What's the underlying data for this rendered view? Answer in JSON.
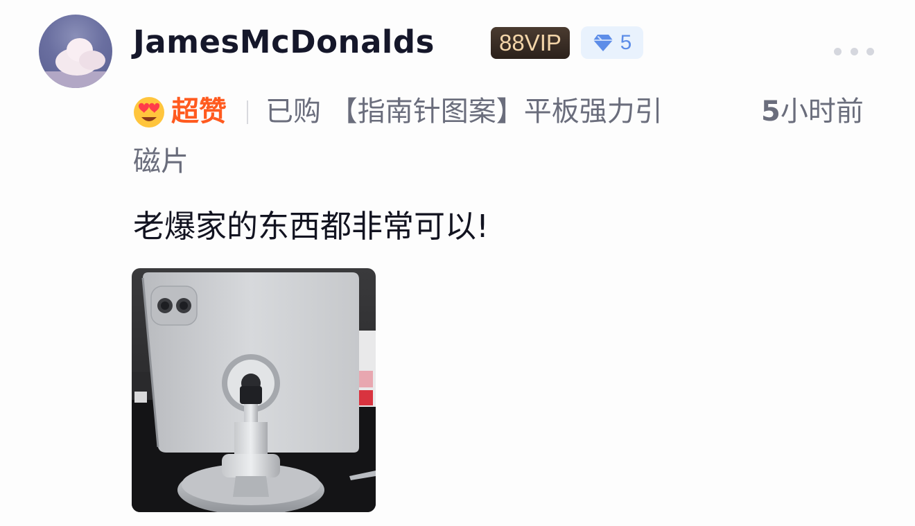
{
  "user": {
    "name": "JamesMcDonalds",
    "vip_badge": "88VIP",
    "level": "5",
    "level_icon": "diamond-icon",
    "avatar_icon": "cloud-avatar"
  },
  "review": {
    "rating_icon": "heart-eyes-emoji-icon",
    "rating_label": "超赞",
    "purchase_line1": "已购 【指南针图案】平板强力引",
    "purchase_line2": "磁片",
    "time_num": "5",
    "time_unit": "小时前",
    "text": "老爆家的东西都非常可以!",
    "photo_icon": "tablet-magnetic-stand-photo"
  },
  "colors": {
    "rating": "#ff5a1f",
    "level_badge_bg": "#e9f2fd",
    "level_text": "#5d8de8",
    "vip_bg": "#2b211b",
    "vip_text": "#f3d5a9"
  }
}
